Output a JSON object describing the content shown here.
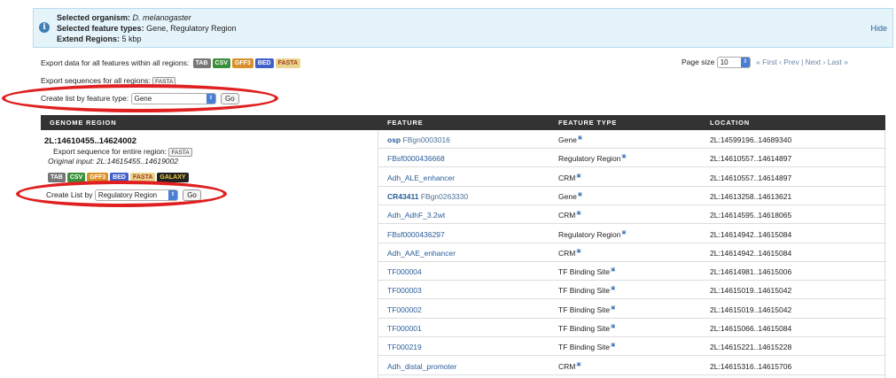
{
  "info": {
    "organism_label": "Selected organism:",
    "organism_value": "D. melanogaster",
    "types_label": "Selected feature types:",
    "types_value": "Gene, Regulatory Region",
    "extend_label": "Extend Regions:",
    "extend_value": "5 kbp",
    "hide": "Hide"
  },
  "export_all": {
    "label": "Export data for all features within all regions:",
    "formats": [
      "TAB",
      "CSV",
      "GFF3",
      "BED",
      "FASTA"
    ]
  },
  "export_seq": {
    "label": "Export sequences for all regions:",
    "button": "FASTA"
  },
  "pager": {
    "label": "Page size",
    "value": "10",
    "nav": "« First ‹ Prev | Next › Last »"
  },
  "create_list_top": {
    "label": "Create list by feature type:",
    "value": "Gene",
    "go": "Go"
  },
  "table": {
    "headers": [
      "GENOME REGION",
      "FEATURE",
      "FEATURE TYPE",
      "LOCATION"
    ],
    "region": {
      "title": "2L:14610455..14624002",
      "export_label": "Export sequence for entire region:",
      "export_button": "FASTA",
      "original": "Original input: 2L:14615455..14619002",
      "formats": [
        "TAB",
        "CSV",
        "GFF3",
        "BED",
        "FASTA",
        "GALAXY"
      ],
      "create_label": "Create List by",
      "create_value": "Regulatory Region",
      "go": "Go"
    },
    "rows": [
      {
        "symbol": "osp",
        "id": "FBgn0003016",
        "type": "Gene",
        "location": "2L:14599196..14689340"
      },
      {
        "symbol": "",
        "id": "FBsf0000436668",
        "type": "Regulatory Region",
        "location": "2L:14610557..14614897"
      },
      {
        "symbol": "",
        "id": "Adh_ALE_enhancer",
        "type": "CRM",
        "location": "2L:14610557..14614897"
      },
      {
        "symbol": "CR43411",
        "id": "FBgn0263330",
        "type": "Gene",
        "location": "2L:14613258..14613621"
      },
      {
        "symbol": "",
        "id": "Adh_AdhF_3.2wt",
        "type": "CRM",
        "location": "2L:14614595..14618065"
      },
      {
        "symbol": "",
        "id": "FBsf0000436297",
        "type": "Regulatory Region",
        "location": "2L:14614942..14615084"
      },
      {
        "symbol": "",
        "id": "Adh_AAE_enhancer",
        "type": "CRM",
        "location": "2L:14614942..14615084"
      },
      {
        "symbol": "",
        "id": "TF000004",
        "type": "TF Binding Site",
        "location": "2L:14614981..14615006"
      },
      {
        "symbol": "",
        "id": "TF000003",
        "type": "TF Binding Site",
        "location": "2L:14615019..14615042"
      },
      {
        "symbol": "",
        "id": "TF000002",
        "type": "TF Binding Site",
        "location": "2L:14615019..14615042"
      },
      {
        "symbol": "",
        "id": "TF000001",
        "type": "TF Binding Site",
        "location": "2L:14615066..14615084"
      },
      {
        "symbol": "",
        "id": "TF000219",
        "type": "TF Binding Site",
        "location": "2L:14615221..14615228"
      },
      {
        "symbol": "",
        "id": "Adh_distal_promoter",
        "type": "CRM",
        "location": "2L:14615316..14615706"
      }
    ]
  },
  "colors": {
    "info_bg": "#e5f3fb",
    "header_bg": "#333333",
    "link": "#2a5d9a",
    "highlight_ellipse": "#e02020"
  }
}
